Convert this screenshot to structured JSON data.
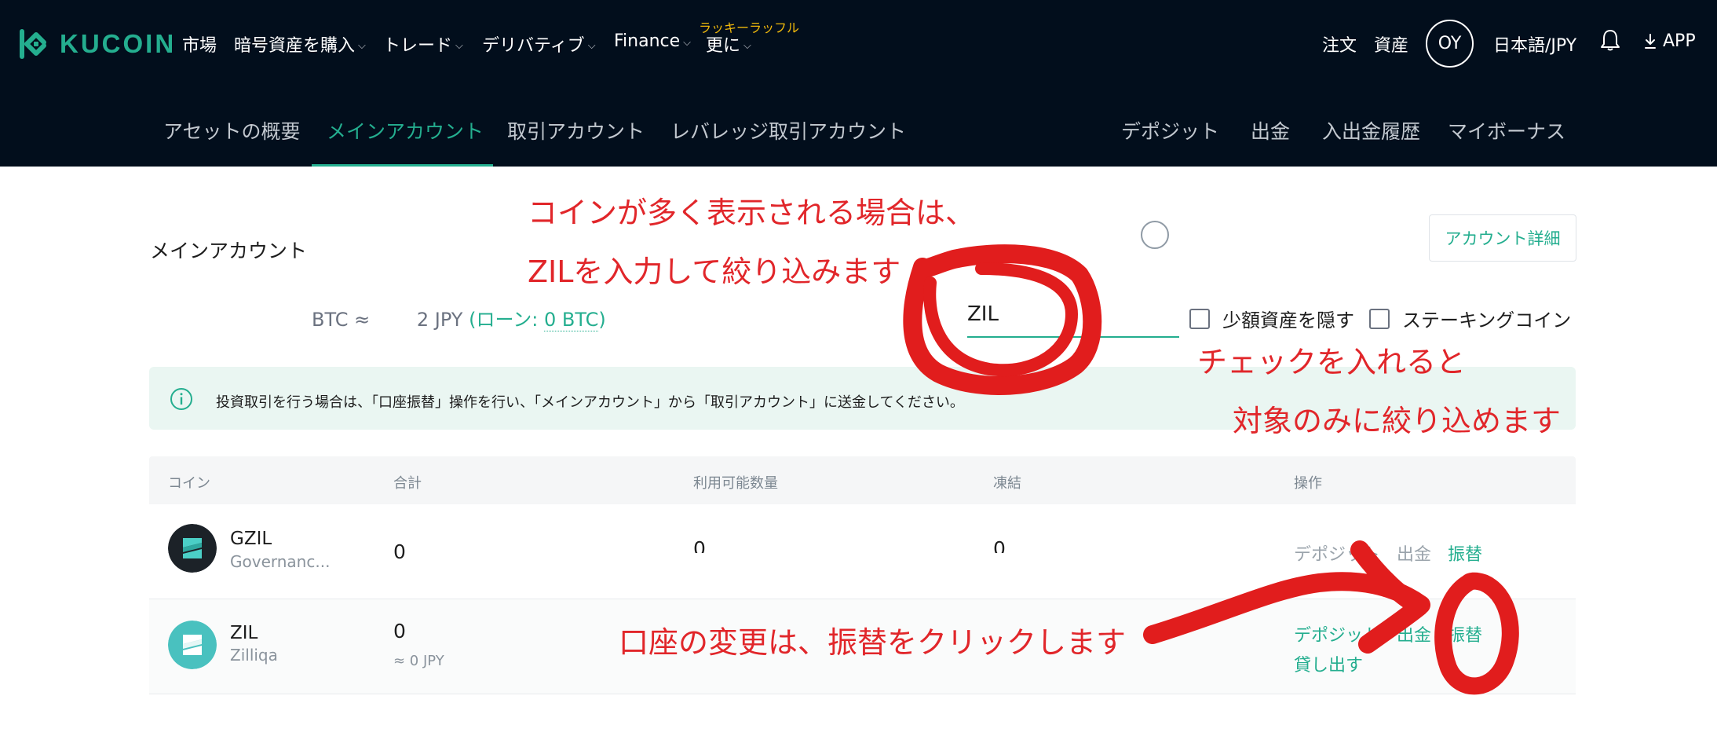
{
  "header": {
    "logo_text": "KUCOIN",
    "nav": [
      {
        "label": "市場"
      },
      {
        "label": "暗号資産を購入"
      },
      {
        "label": "トレード"
      },
      {
        "label": "デリバティブ"
      },
      {
        "label": "Finance"
      },
      {
        "label": "更に"
      }
    ],
    "raffle_label": "ラッキーラッフル",
    "orders_label": "注文",
    "assets_label": "資産",
    "avatar_initials": "OY",
    "language_label": "日本語/JPY",
    "app_label": "APP"
  },
  "subnav": {
    "tabs": [
      {
        "label": "アセットの概要"
      },
      {
        "label": "メインアカウント"
      },
      {
        "label": "取引アカウント"
      },
      {
        "label": "レバレッジ取引アカウント"
      }
    ],
    "right": [
      {
        "label": "デポジット"
      },
      {
        "label": "出金"
      },
      {
        "label": "入出金履歴"
      },
      {
        "label": "マイボーナス"
      }
    ],
    "active_tab": "メインアカウント"
  },
  "main": {
    "title": "メインアカウント",
    "detail_button": "アカウント詳細",
    "balance": {
      "btc_prefix": "BTC ≈",
      "jpy_part": "JPY",
      "loan_open": "(ローン: ",
      "loan_value": "0 BTC",
      "loan_close": ")"
    },
    "search": {
      "value": "ZIL"
    },
    "hide_small_label": "少額資産を隠す",
    "staking_label": "ステーキングコイン",
    "notice": "投資取引を行う場合は、「口座振替」操作を行い、「メインアカウント」から「取引アカウント」に送金してください。"
  },
  "table": {
    "headers": {
      "coin": "コイン",
      "total": "合計",
      "available": "利用可能数量",
      "frozen": "凍結",
      "actions": "操作"
    },
    "rows": [
      {
        "symbol": "GZIL",
        "name": "Governanc...",
        "total": "0",
        "available": "0",
        "frozen": "0",
        "deposit": "デポジット",
        "withdraw": "出金",
        "transfer": "振替"
      },
      {
        "symbol": "ZIL",
        "name": "Zilliqa",
        "total": "0",
        "total_jpy": "≈ 0 JPY",
        "deposit": "デポジット",
        "withdraw": "出金",
        "transfer": "振替",
        "lend": "貸し出す"
      }
    ]
  },
  "annotations": {
    "line1": "コインが多く表示される場合は、",
    "line2": "ZILを入力して絞り込みます",
    "check1": "チェックを入れると",
    "check2": "対象のみに絞り込めます",
    "transfer_note": "口座の変更は、振替をクリックします"
  },
  "colors": {
    "nav_bg": "#020e1c",
    "accent": "#24ae8f",
    "annotation": "#e1262a",
    "raffle": "#f0b90b"
  }
}
